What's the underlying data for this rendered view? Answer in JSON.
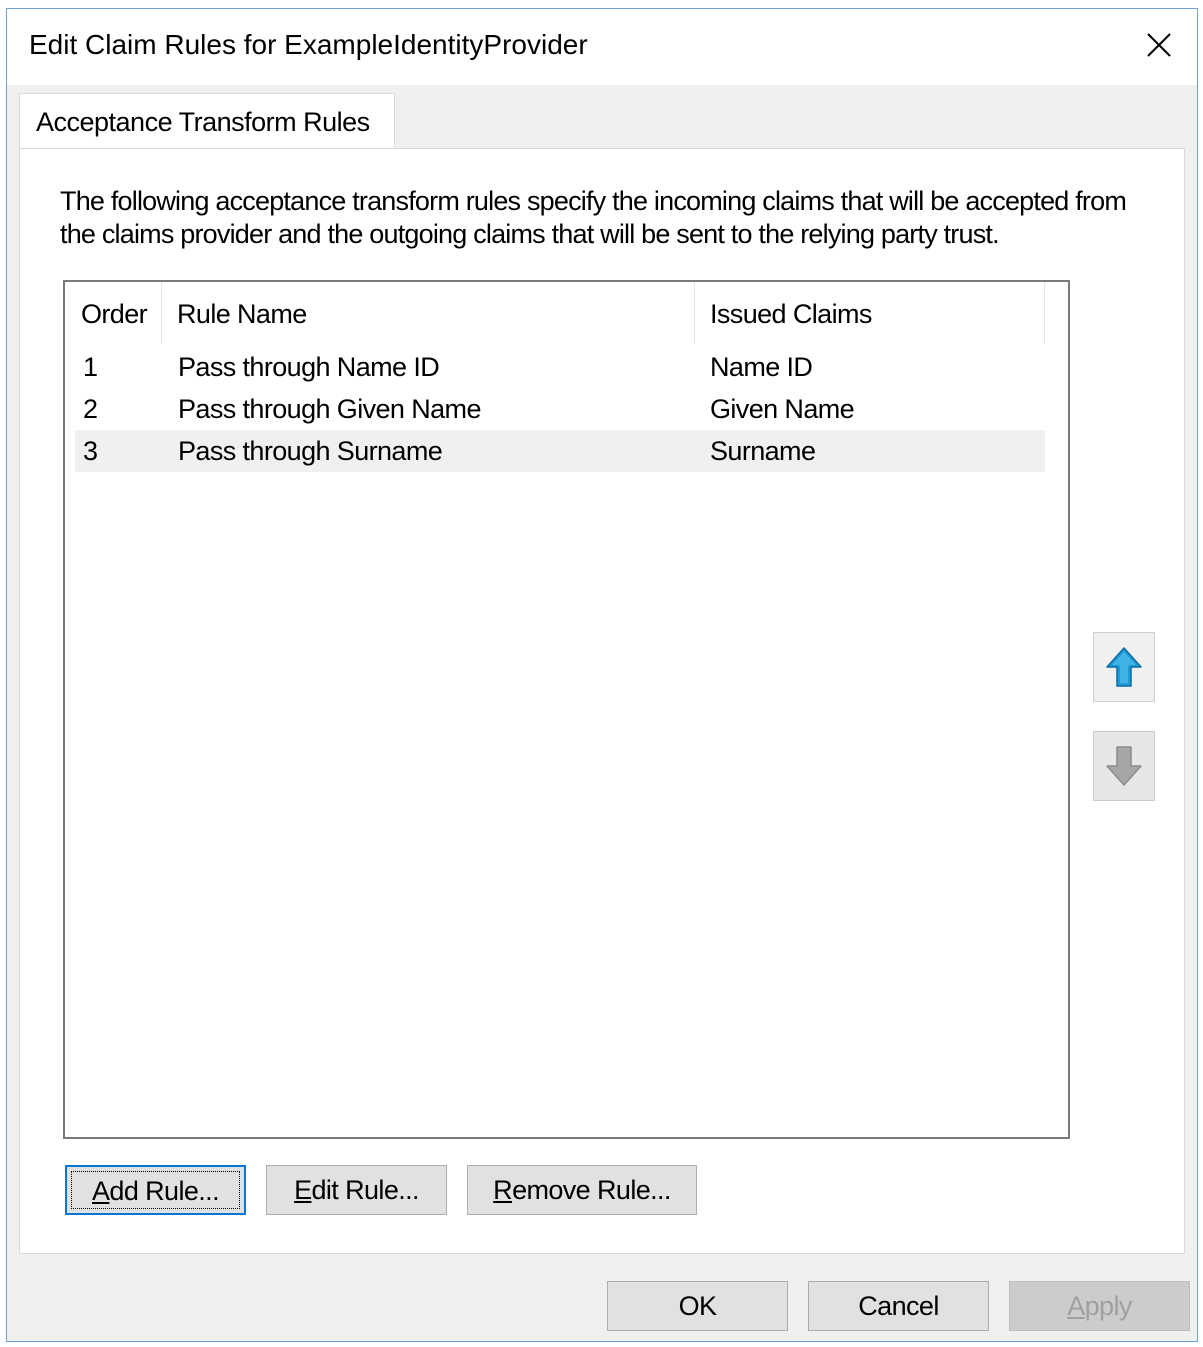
{
  "window": {
    "title": "Edit Claim Rules for ExampleIdentityProvider"
  },
  "tabs": [
    {
      "label": "Acceptance Transform Rules",
      "selected": true
    }
  ],
  "description": "The following acceptance transform rules specify the incoming claims that will be accepted from the claims provider and the outgoing claims that will be sent to the relying party trust.",
  "rules_table": {
    "columns": [
      "Order",
      "Rule Name",
      "Issued Claims"
    ],
    "rows": [
      {
        "order": "1",
        "rule_name": "Pass through Name ID",
        "issued_claims": "Name ID",
        "selected": false
      },
      {
        "order": "2",
        "rule_name": "Pass through Given Name",
        "issued_claims": "Given Name",
        "selected": false
      },
      {
        "order": "3",
        "rule_name": "Pass through Surname",
        "issued_claims": "Surname",
        "selected": true
      }
    ]
  },
  "rule_buttons": {
    "add": {
      "mnemonic": "A",
      "rest": "dd Rule..."
    },
    "edit": {
      "mnemonic": "E",
      "rest": "dit Rule..."
    },
    "remove": {
      "mnemonic": "R",
      "rest": "emove Rule..."
    }
  },
  "order_buttons": {
    "move_up_icon": "arrow-up-icon",
    "move_down_icon": "arrow-down-icon",
    "move_down_enabled": false
  },
  "dialog_buttons": {
    "ok": "OK",
    "cancel": "Cancel",
    "apply": {
      "mnemonic": "A",
      "rest": "pply",
      "enabled": false
    }
  },
  "colors": {
    "accent": "#0078d7",
    "arrow_up": "#1e9bd7",
    "arrow_disabled": "#a6a6a6",
    "selected_row": "#f0f0f0"
  }
}
